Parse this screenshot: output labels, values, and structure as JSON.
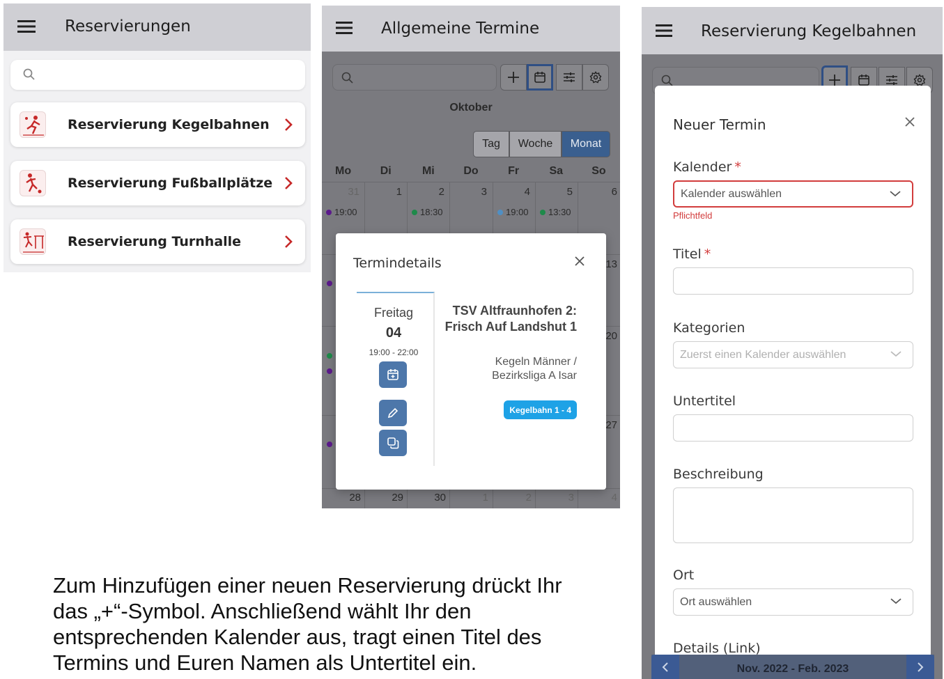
{
  "panel_list": {
    "title": "Reservierungen",
    "items": [
      {
        "label": "Reservierung Kegelbahnen"
      },
      {
        "label": "Reservierung Fußballplätze"
      },
      {
        "label": "Reservierung Turnhalle"
      }
    ]
  },
  "panel_calendar": {
    "title": "Allgemeine Termine",
    "month": "Oktober",
    "views": [
      "Tag",
      "Woche",
      "Monat"
    ],
    "active_view": "Monat",
    "weekdays": [
      "Mo",
      "Di",
      "Mi",
      "Do",
      "Fr",
      "Sa",
      "So"
    ],
    "week1_days": [
      "31",
      "1",
      "2",
      "3",
      "4",
      "5",
      "6"
    ],
    "week1_events": [
      {
        "time": "19:00",
        "color": "#5b1a8c"
      },
      {
        "time": "18:30",
        "color": "#1e8a4a"
      },
      {
        "time": "19:00",
        "color": "#4f8fc4"
      },
      {
        "time": "13:30",
        "color": "#1e8a4a"
      }
    ],
    "side_numbers": [
      "13",
      "20",
      "27"
    ],
    "last_week_days": [
      "28",
      "29",
      "30",
      "1",
      "2",
      "3",
      "4"
    ],
    "dot_colors": {
      "purple": "#5b1a8c",
      "green": "#1e8a4a"
    },
    "modal": {
      "title": "Termindetails",
      "weekday": "Freitag",
      "day": "04",
      "time_range": "19:00 - 22:00",
      "event_title": "TSV Altfraunhofen 2: Frisch Auf Landshut 1",
      "event_subtitle": "Kegeln Männer / Bezirksliga A Isar",
      "badge": "Kegelbahn 1 - 4"
    }
  },
  "panel_form": {
    "title": "Reservierung Kegelbahnen",
    "form_title": "Neuer Termin",
    "fields": {
      "kalender": {
        "label": "Kalender",
        "placeholder": "Kalender auswählen",
        "error": "Pflichtfeld"
      },
      "titel": {
        "label": "Titel"
      },
      "kategorien": {
        "label": "Kategorien",
        "placeholder": "Zuerst einen Kalender auswählen"
      },
      "untertitel": {
        "label": "Untertitel"
      },
      "beschreibung": {
        "label": "Beschreibung"
      },
      "ort": {
        "label": "Ort",
        "placeholder": "Ort auswählen"
      },
      "details": {
        "label": "Details (Link)"
      }
    },
    "required_mark": "*",
    "date_range": "Nov. 2022 - Feb. 2023"
  },
  "caption": "Zum Hinzufügen einer neuen Reservierung drückt Ihr das „+“-Symbol. Anschließend wählt Ihr den entsprechenden Kalender aus, tragt einen Titel des Termins und Euren Namen als Untertitel ein."
}
